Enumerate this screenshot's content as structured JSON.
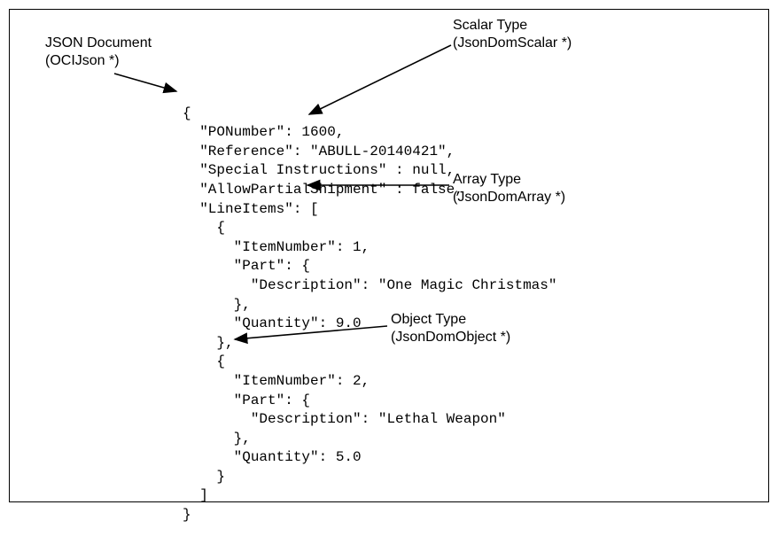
{
  "labels": {
    "jsonDocument": "JSON Document\n(OCIJson *)",
    "scalarType": "Scalar Type\n(JsonDomScalar *)",
    "arrayType": "Array Type\n(JsonDomArray *)",
    "objectType": "Object Type\n(JsonDomObject *)"
  },
  "code": {
    "l1": "{",
    "l2": "  \"PONumber\": 1600,",
    "l3": "  \"Reference\": \"ABULL-20140421\",",
    "l4": "  \"Special Instructions\" : null,",
    "l5": "  \"AllowPartialShipment\" : false,",
    "l6": "  \"LineItems\": [",
    "l7": "    {",
    "l8": "      \"ItemNumber\": 1,",
    "l9": "      \"Part\": {",
    "l10": "        \"Description\": \"One Magic Christmas\"",
    "l11": "      },",
    "l12": "      \"Quantity\": 9.0",
    "l13": "    },",
    "l14": "    {",
    "l15": "      \"ItemNumber\": 2,",
    "l16": "      \"Part\": {",
    "l17": "        \"Description\": \"Lethal Weapon\"",
    "l18": "      },",
    "l19": "      \"Quantity\": 5.0",
    "l20": "    }",
    "l21": "  ]",
    "l22": "}"
  },
  "json_document": {
    "PONumber": 1600,
    "Reference": "ABULL-20140421",
    "Special Instructions": null,
    "AllowPartialShipment": false,
    "LineItems": [
      {
        "ItemNumber": 1,
        "Part": {
          "Description": "One Magic Christmas"
        },
        "Quantity": 9.0
      },
      {
        "ItemNumber": 2,
        "Part": {
          "Description": "Lethal Weapon"
        },
        "Quantity": 5.0
      }
    ]
  }
}
